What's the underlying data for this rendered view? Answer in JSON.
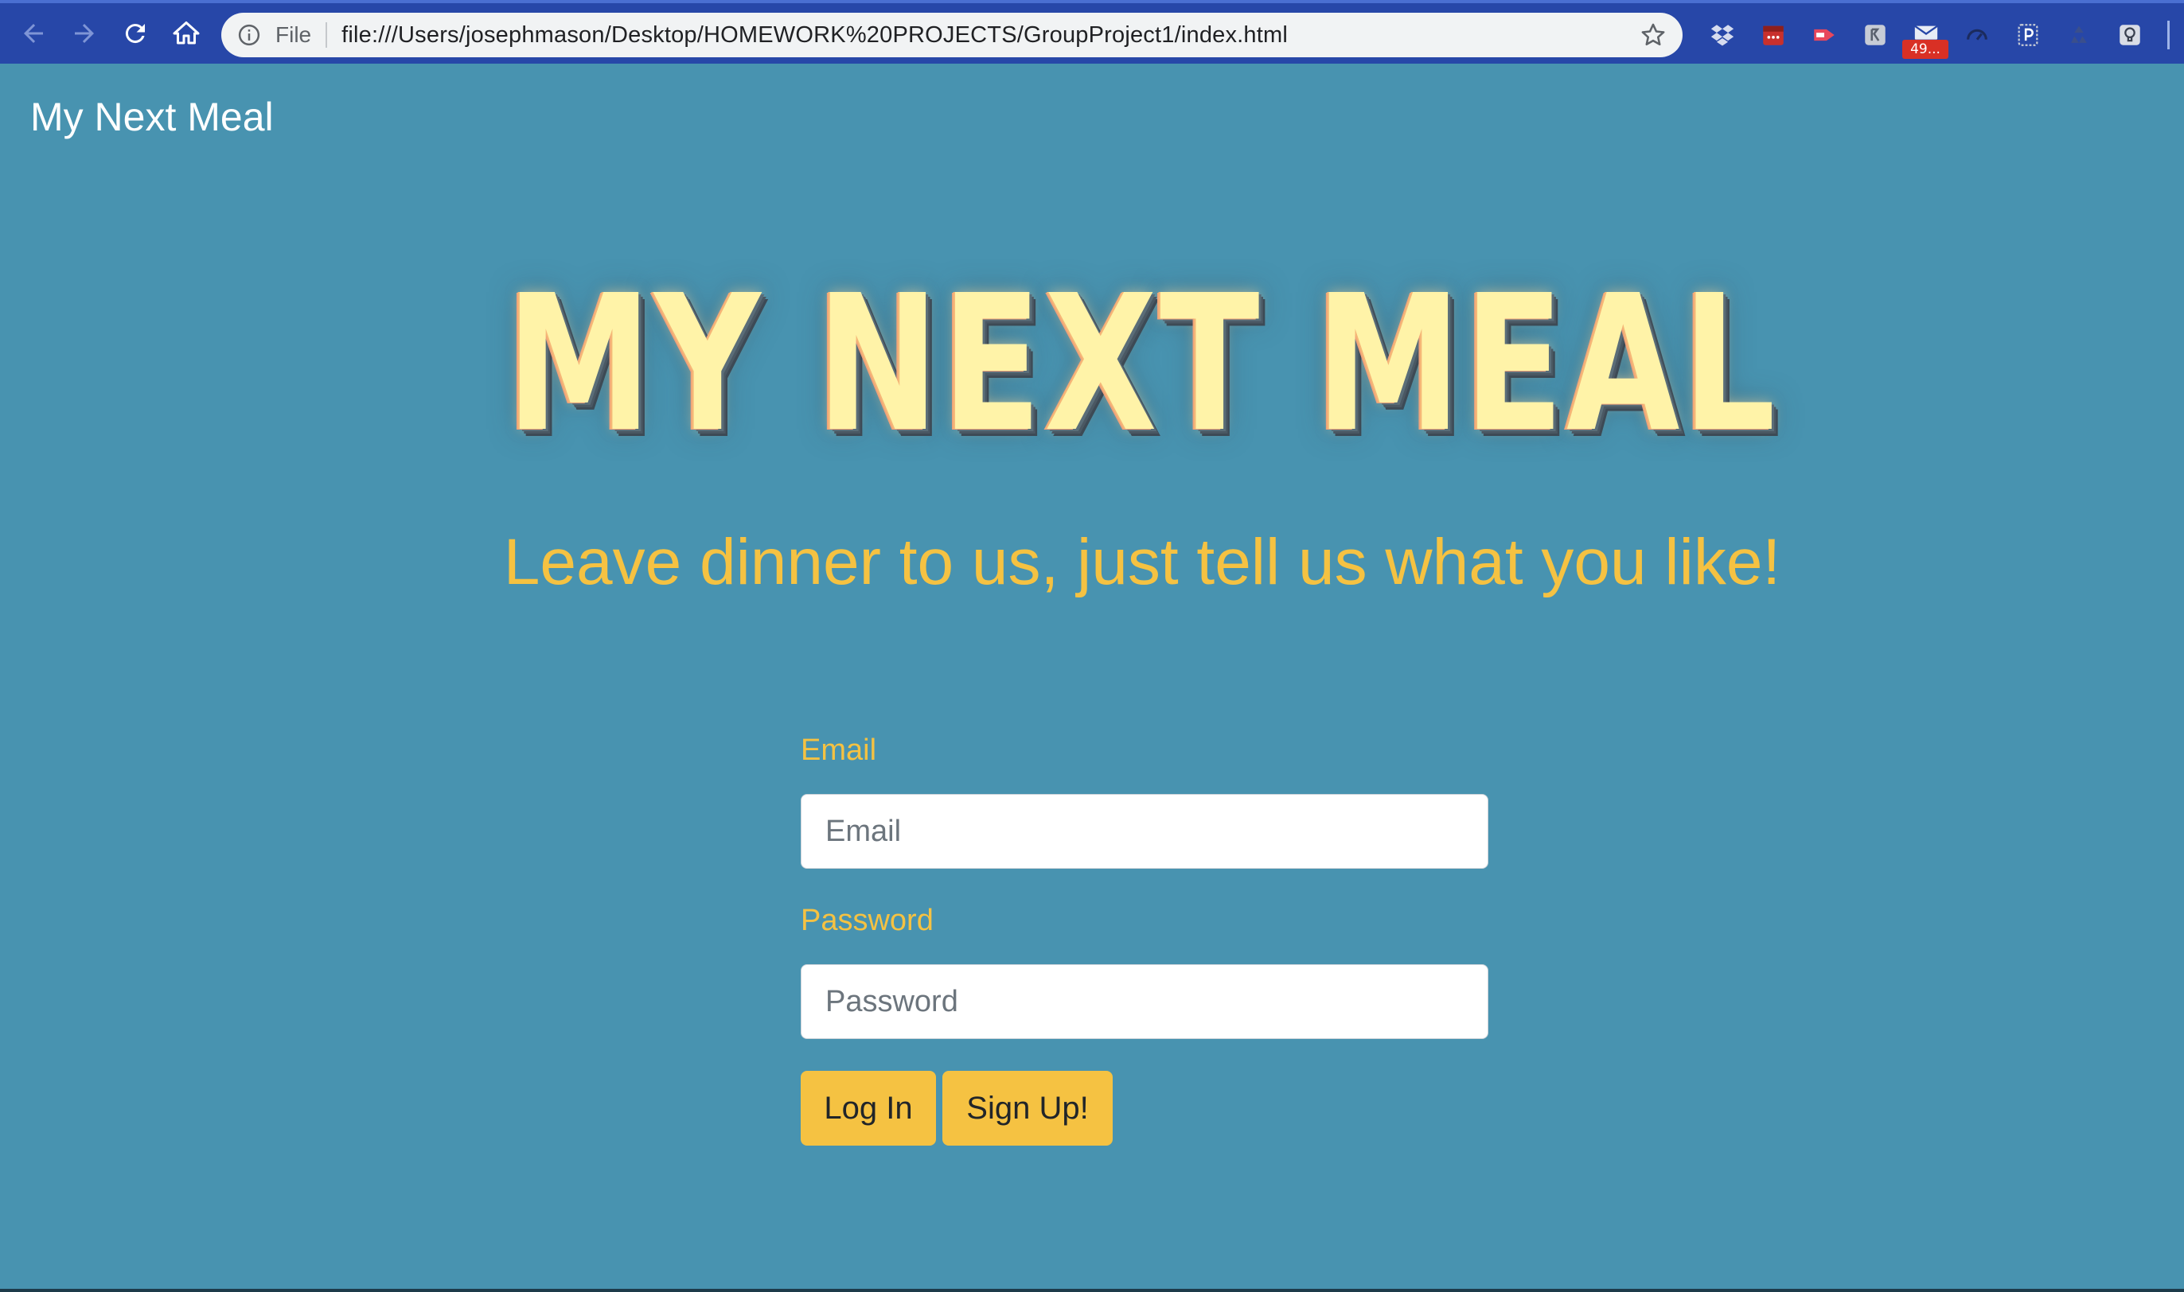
{
  "browser": {
    "file_label": "File",
    "url": "file:///Users/josephmason/Desktop/HOMEWORK%20PROJECTS/GroupProject1/index.html",
    "mail_badge": "49...",
    "icons": [
      "back-arrow-icon",
      "forward-arrow-icon",
      "reload-icon",
      "home-icon",
      "info-icon",
      "star-icon",
      "dropbox-icon",
      "calendar-extension-icon",
      "screencast-extension-icon",
      "translate-extension-icon",
      "mail-extension-icon",
      "speed-extension-icon",
      "pocket-extension-icon",
      "recycle-extension-icon",
      "lightbulb-extension-icon"
    ]
  },
  "navbar": {
    "brand": "My Next Meal"
  },
  "hero": {
    "title": "MY NEXT MEAL",
    "tagline": "Leave dinner to us, just tell us what you like!"
  },
  "login_form": {
    "email_label": "Email",
    "email_placeholder": "Email",
    "password_label": "Password",
    "password_placeholder": "Password",
    "login_button": "Log In",
    "signup_button": "Sign Up!"
  },
  "colors": {
    "page_background": "#4893b0",
    "accent_yellow": "#f5c242",
    "chrome_blue": "#2747a8"
  }
}
